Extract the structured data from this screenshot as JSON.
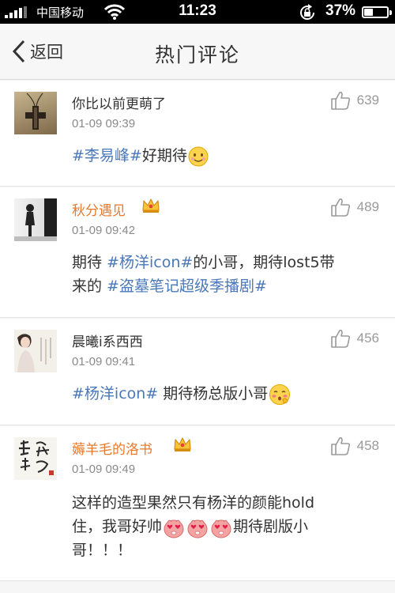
{
  "status_bar": {
    "carrier": "中国移动",
    "time": "11:23",
    "battery_percent": "37%",
    "battery_level": 0.37
  },
  "nav": {
    "back_label": "返回",
    "title": "热门评论"
  },
  "comments": [
    {
      "username": "你比以前更萌了",
      "time": "01-09 09:39",
      "likes": "639",
      "text": [
        "#李易峰#",
        "好期待"
      ]
    },
    {
      "username": "秋分遇见",
      "time": "01-09 09:42",
      "likes": "489",
      "text": [
        "期待 ",
        "#杨洋icon#",
        "的小哥，期待lost5带",
        "来的 ",
        "#盗墓笔记超级季播剧#"
      ]
    },
    {
      "username": "晨曦i系西西",
      "time": "01-09 09:41",
      "likes": "456",
      "text": [
        "#杨洋icon#",
        " 期待杨总版小哥"
      ]
    },
    {
      "username": "薅羊毛的洛书",
      "time": "01-09 09:49",
      "likes": "458",
      "text": [
        "这样的造型果然只有杨洋的颜能hold",
        "住，我哥好帅",
        "期待剧版小",
        "哥！！！"
      ]
    }
  ],
  "colors": {
    "vip_name": "#e8782c",
    "topic_link": "#4a78b8",
    "timestamp": "#8a8a8a"
  },
  "icons": [
    "signal-bars-icon",
    "wifi-icon",
    "rotation-lock-icon",
    "battery-icon",
    "back-chevron-icon",
    "thumbs-up-icon",
    "vip-crown-icon",
    "smile-emoji-icon",
    "shy-emoji-icon",
    "heart-eyes-emoji-icon"
  ]
}
